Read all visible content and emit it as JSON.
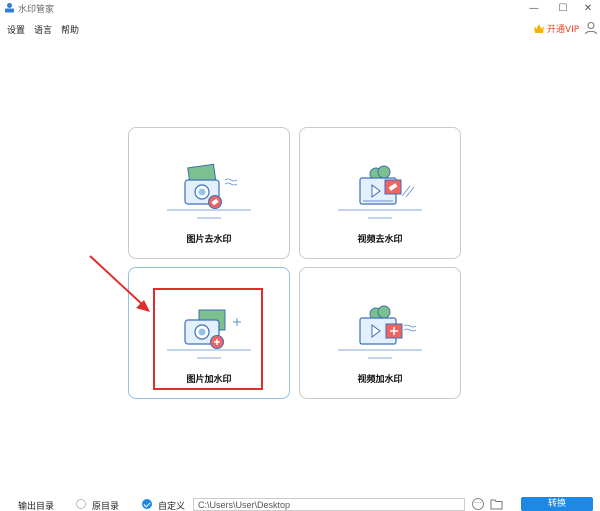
{
  "window": {
    "title": "水印管家",
    "minimize": "—",
    "maximize": "☐",
    "close": "✕"
  },
  "menu": {
    "items": [
      "设置",
      "语言",
      "帮助"
    ],
    "vip_label": "开通VIP"
  },
  "cards": [
    {
      "label": "图片去水印"
    },
    {
      "label": "视频去水印"
    },
    {
      "label": "图片加水印"
    },
    {
      "label": "视频加水印"
    }
  ],
  "bottom": {
    "output_label": "输出目录",
    "option_original": "原目录",
    "option_custom": "自定义",
    "path_value": "C:\\Users\\User\\Desktop",
    "more_label": "···",
    "convert_label": "转换"
  },
  "colors": {
    "accent": "#1e88e5",
    "highlight": "#e02d2d",
    "vip": "#e8432d"
  }
}
